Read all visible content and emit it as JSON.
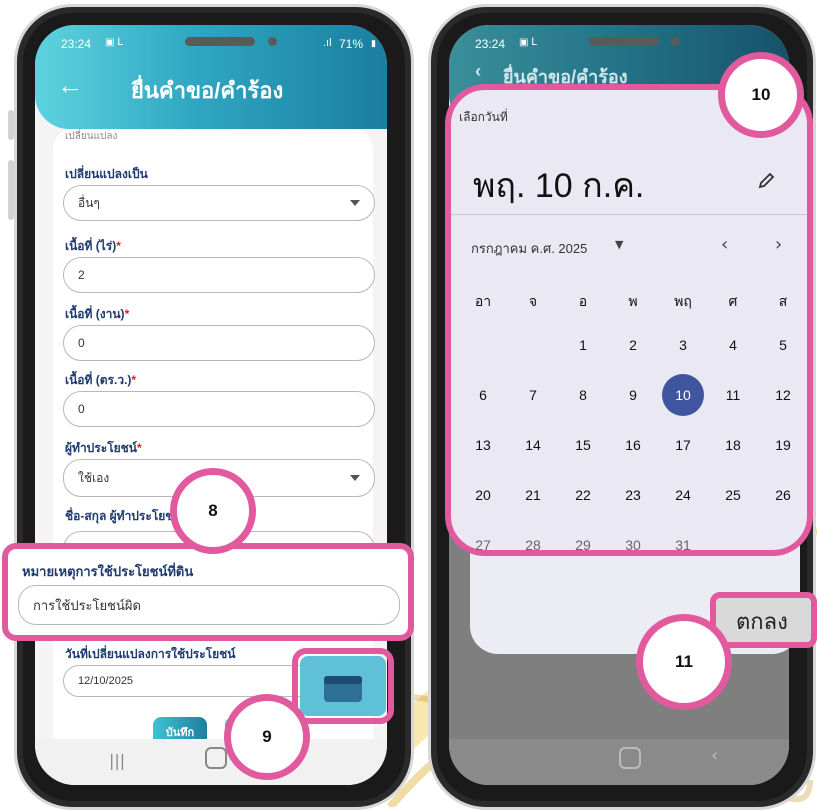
{
  "left": {
    "status": {
      "time": "23:24",
      "battery": "71%"
    },
    "header": {
      "title": "ยื่นคำขอ/คำร้อง"
    },
    "form": {
      "top_partial": "เปลี่ยนแปลง",
      "change_to": {
        "label": "เปลี่ยนแปลงเป็น",
        "value": "อื่นๆ"
      },
      "area_rai": {
        "label": "เนื้อที่ (ไร่)",
        "value": "2"
      },
      "area_ngan": {
        "label": "เนื้อที่ (งาน)",
        "value": "0"
      },
      "area_wa": {
        "label": "เนื้อที่ (ตร.ว.)",
        "value": "0"
      },
      "beneficiary": {
        "label": "ผู้ทำประโยชน์",
        "value": "ใช้เอง"
      },
      "beneficiary_name": {
        "label": "ชื่อ-สกุล ผู้ทำประโยชน์"
      },
      "remark": {
        "label": "หมายเหตุการใช้ประโยชน์ที่ดิน",
        "value": "การใช้ประโยชน์ผิด"
      },
      "date": {
        "label": "วันที่เปลี่ยนแปลงการใช้ประโยชน์",
        "value": "12/10/2025"
      },
      "save_button": "บันทึก"
    },
    "markers": {
      "m8": "8",
      "m9": "9"
    }
  },
  "right": {
    "status": {
      "time": "23:24"
    },
    "header": {
      "title": "ยื่นคำขอ/คำร้อง"
    },
    "dialog": {
      "heading": "เลือกวันที่",
      "selected_display": "พฤ. 10 ก.ค.",
      "month_label": "กรกฎาคม ค.ศ. 2025",
      "weekdays": [
        "อา",
        "จ",
        "อ",
        "พ",
        "พฤ",
        "ศ",
        "ส"
      ],
      "days": [
        "1",
        "2",
        "3",
        "4",
        "5",
        "6",
        "7",
        "8",
        "9",
        "10",
        "11",
        "12",
        "13",
        "14",
        "15",
        "16",
        "17",
        "18",
        "19",
        "20",
        "21",
        "22",
        "23",
        "24",
        "25",
        "26",
        "27",
        "28",
        "29",
        "30",
        "31"
      ],
      "selected_day": "10",
      "ok_button": "ตกลง"
    },
    "markers": {
      "m10": "10",
      "m11": "11"
    }
  },
  "colors": {
    "accent_pink": "#e25a9e",
    "header_teal": "#2fa7c2",
    "selected_day": "#3f55a0",
    "label_navy": "#1f3b70"
  },
  "icons": [
    "back-arrow-icon",
    "pencil-icon",
    "chevron-left-icon",
    "chevron-right-icon",
    "calendar-icon"
  ]
}
